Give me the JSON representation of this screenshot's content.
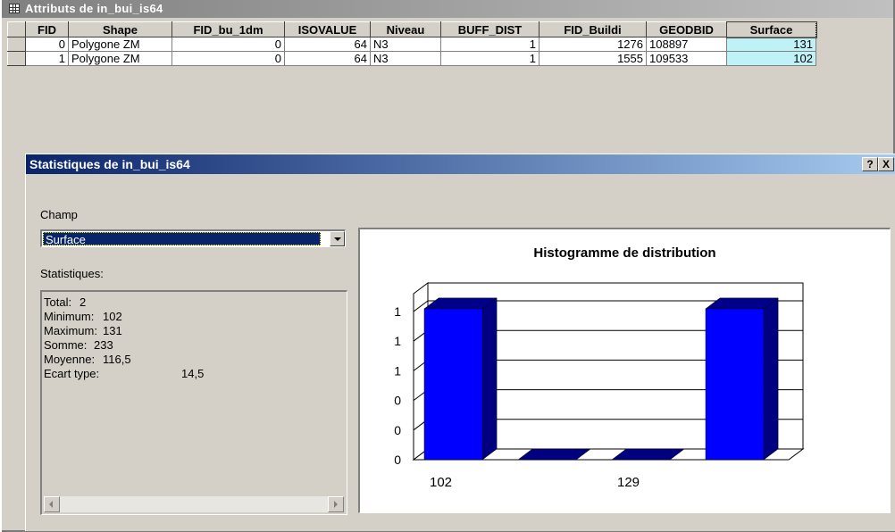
{
  "window_title": "Attributs de  in_bui_is64",
  "table": {
    "columns": [
      "FID",
      "Shape",
      "FID_bu_1dm",
      "ISOVALUE",
      "Niveau",
      "BUFF_DIST",
      "FID_Buildi",
      "GEODBID",
      "Surface"
    ],
    "rows": [
      [
        "0",
        "Polygone ZM",
        "0",
        "64",
        "N3",
        "1",
        "1276",
        "108897",
        "131"
      ],
      [
        "1",
        "Polygone ZM",
        "0",
        "64",
        "N3",
        "1",
        "1555",
        "109533",
        "102"
      ]
    ]
  },
  "dialog": {
    "title": "Statistiques de in_bui_is64",
    "help_label": "?",
    "close_label": "X",
    "field_label": "Champ",
    "field_value": "Surface",
    "stats_label": "Statistiques:",
    "stats": [
      {
        "label": "Total:",
        "value": "2"
      },
      {
        "label": "Minimum:",
        "value": "102"
      },
      {
        "label": "Maximum:",
        "value": "131"
      },
      {
        "label": "Somme:",
        "value": "233"
      },
      {
        "label": "Moyenne:",
        "value": "116,5"
      },
      {
        "label": "Ecart type:",
        "value": "14,5"
      }
    ]
  },
  "colors": {
    "bar_front": "#0000ff",
    "bar_side": "#000080",
    "bar_top": "#00008b",
    "highlight": "#bef2f7"
  },
  "chart_data": {
    "type": "bar",
    "title": "Histogramme de distribution",
    "xlabel": "",
    "ylabel": "",
    "y_tick_labels": [
      "0",
      "0",
      "0",
      "1",
      "1",
      "1"
    ],
    "x_tick_labels": [
      "102",
      "129"
    ],
    "values": [
      1,
      0,
      0,
      1
    ],
    "ylim": [
      0,
      1.1
    ],
    "grid": true,
    "style": "3d"
  }
}
